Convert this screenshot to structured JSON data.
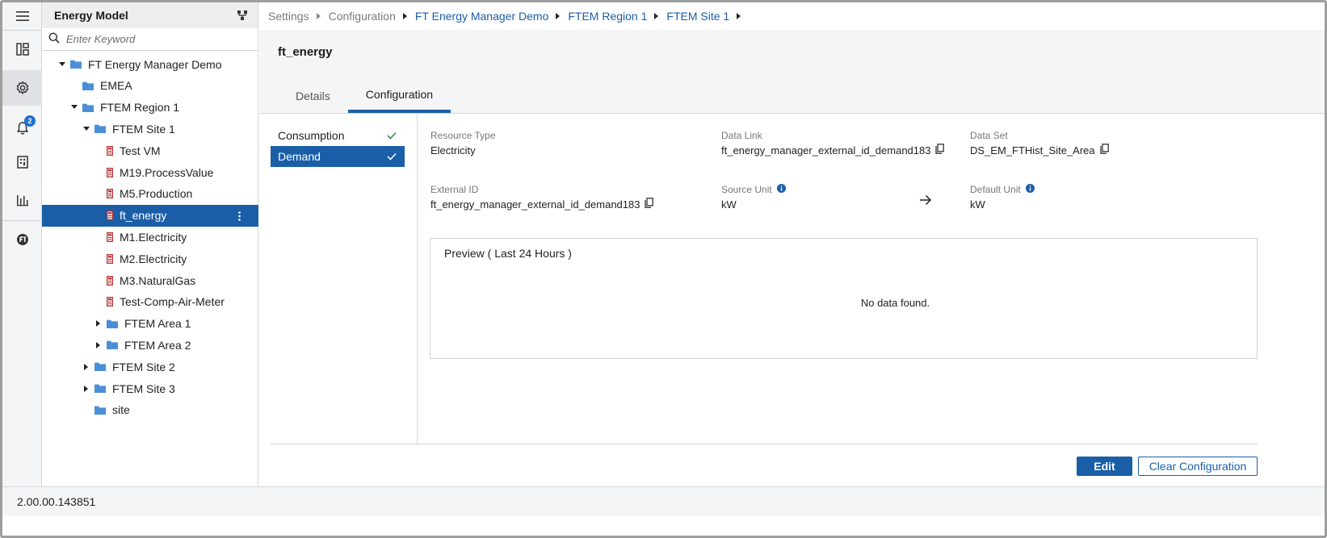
{
  "tree": {
    "title": "Energy Model",
    "search_placeholder": "Enter Keyword",
    "nodes": [
      {
        "label": "FT Energy Manager Demo",
        "caret": "down",
        "icon": "folder-icon"
      },
      {
        "label": "EMEA",
        "caret": "none",
        "icon": "folder-icon"
      },
      {
        "label": "FTEM Region 1",
        "caret": "down",
        "icon": "folder-icon"
      },
      {
        "label": "FTEM Site 1",
        "caret": "down",
        "icon": "folder-icon"
      },
      {
        "label": "Test VM",
        "caret": "none",
        "icon": "meter-icon"
      },
      {
        "label": "M19.ProcessValue",
        "caret": "none",
        "icon": "meter-icon"
      },
      {
        "label": "M5.Production",
        "caret": "none",
        "icon": "meter-icon"
      },
      {
        "label": "ft_energy",
        "caret": "none",
        "icon": "meter-icon"
      },
      {
        "label": "M1.Electricity",
        "caret": "none",
        "icon": "meter-icon"
      },
      {
        "label": "M2.Electricity",
        "caret": "none",
        "icon": "meter-icon"
      },
      {
        "label": "M3.NaturalGas",
        "caret": "none",
        "icon": "meter-icon"
      },
      {
        "label": "Test-Comp-Air-Meter",
        "caret": "none",
        "icon": "meter-icon"
      },
      {
        "label": "FTEM Area 1",
        "caret": "right",
        "icon": "folder-icon"
      },
      {
        "label": "FTEM Area 2",
        "caret": "right",
        "icon": "folder-icon"
      },
      {
        "label": "FTEM Site 2",
        "caret": "right",
        "icon": "folder-icon"
      },
      {
        "label": "FTEM Site 3",
        "caret": "right",
        "icon": "folder-icon"
      },
      {
        "label": "site",
        "caret": "none",
        "icon": "folder-icon"
      }
    ],
    "selected_label": "ft_energy"
  },
  "rail": {
    "icons": [
      "menu-icon",
      "dashboard-icon",
      "settings-icon",
      "notifications-icon",
      "reports-icon",
      "analytics-icon",
      "ft-logo-icon"
    ],
    "notification_count": "2"
  },
  "breadcrumb": [
    {
      "label": "Settings",
      "link": false
    },
    {
      "label": "Configuration",
      "link": false
    },
    {
      "label": "FT Energy Manager Demo",
      "link": true
    },
    {
      "label": "FTEM Region 1",
      "link": true
    },
    {
      "label": "FTEM Site 1",
      "link": true
    }
  ],
  "page": {
    "title": "ft_energy",
    "tabs": [
      "Details",
      "Configuration"
    ],
    "active_tab": "Configuration"
  },
  "config": {
    "types": [
      {
        "label": "Consumption",
        "checked": true
      },
      {
        "label": "Demand",
        "checked": true
      }
    ],
    "active_type": "Demand",
    "resource_type": {
      "label": "Resource Type",
      "value": "Electricity"
    },
    "data_link": {
      "label": "Data Link",
      "value": "ft_energy_manager_external_id_demand183"
    },
    "data_set": {
      "label": "Data Set",
      "value": "DS_EM_FTHist_Site_Area"
    },
    "external_id": {
      "label": "External ID",
      "value": "ft_energy_manager_external_id_demand183"
    },
    "source_unit": {
      "label": "Source Unit",
      "value": "kW"
    },
    "default_unit": {
      "label": "Default Unit",
      "value": "kW"
    },
    "preview_title": "Preview ( Last 24 Hours )",
    "preview_empty": "No data found."
  },
  "actions": {
    "edit_label": "Edit",
    "clear_label": "Clear Configuration"
  },
  "footer": {
    "version": "2.00.00.143851"
  },
  "colors": {
    "accent": "#1b5ea8",
    "check_green": "#2e8b3a"
  }
}
